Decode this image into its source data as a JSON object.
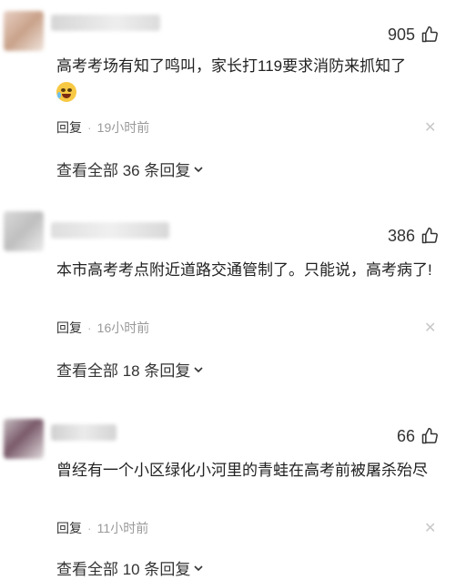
{
  "comments": [
    {
      "likes": "905",
      "text": "高考考场有知了鸣叫，家长打119要求消防来抓知了",
      "emoji": "crying-face-emoji",
      "reply_label": "回复",
      "separator": "·",
      "time": "19小时前",
      "view_all": "查看全部 36 条回复"
    },
    {
      "likes": "386",
      "text": "本市高考考点附近道路交通管制了。只能说，高考病了!",
      "reply_label": "回复",
      "separator": "·",
      "time": "16小时前",
      "view_all": "查看全部 18 条回复"
    },
    {
      "likes": "66",
      "text": "曾经有一个小区绿化小河里的青蛙在高考前被屠杀殆尽",
      "reply_label": "回复",
      "separator": "·",
      "time": "11小时前",
      "view_all": "查看全部 10 条回复"
    }
  ],
  "icons": {
    "like": "thumbs-up-icon",
    "close": "close-icon",
    "expand": "chevron-down-icon"
  },
  "colors": {
    "text": "#222222",
    "muted": "#999999",
    "close": "#c8c8c8"
  }
}
